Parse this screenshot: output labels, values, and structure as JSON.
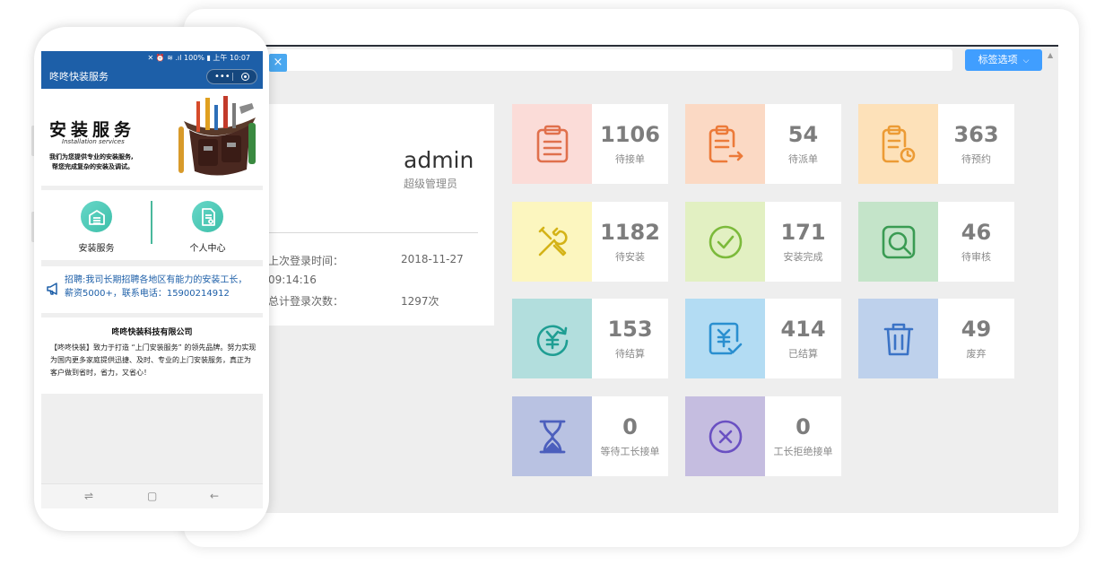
{
  "toolbar": {
    "close_glyph": "×",
    "options_label": "标签选项",
    "options_chevron": "⌵",
    "scroll_up": "▲"
  },
  "profile": {
    "name": "admin",
    "role": "超级管理员",
    "last_login_label": "上次登录时间：",
    "last_login_date": "2018-11-27",
    "last_login_time": "09:14:16",
    "login_count_label": "总计登录次数：",
    "login_count_value": "1297次"
  },
  "stats": [
    {
      "count": "1106",
      "label": "待接单",
      "icon": "clipboard-list-icon",
      "bg": "#fbdcd8",
      "color": "#e0704c"
    },
    {
      "count": "54",
      "label": "待派单",
      "icon": "clipboard-dispatch-icon",
      "bg": "#fbd9c4",
      "color": "#ec7a39"
    },
    {
      "count": "363",
      "label": "待预约",
      "icon": "clipboard-clock-icon",
      "bg": "#fde1b9",
      "color": "#ec9b35"
    },
    {
      "count": "1182",
      "label": "待安装",
      "icon": "tools-icon",
      "bg": "#fcf6bf",
      "color": "#d4b317"
    },
    {
      "count": "171",
      "label": "安装完成",
      "icon": "check-circle-icon",
      "bg": "#e2f0c2",
      "color": "#7cba3b"
    },
    {
      "count": "46",
      "label": "待审核",
      "icon": "search-check-icon",
      "bg": "#c4e4c9",
      "color": "#3a9b53"
    },
    {
      "count": "153",
      "label": "待结算",
      "icon": "yuan-refresh-icon",
      "bg": "#b2dedd",
      "color": "#1f9e93"
    },
    {
      "count": "414",
      "label": "已结算",
      "icon": "settled-check-icon",
      "bg": "#b3dcf3",
      "color": "#2a8fd0"
    },
    {
      "count": "49",
      "label": "废弃",
      "icon": "trash-icon",
      "bg": "#bed1ec",
      "color": "#3b73c6"
    },
    {
      "count": "0",
      "label": "等待工长接单",
      "icon": "hourglass-icon",
      "bg": "#b9c2e2",
      "color": "#4c5fbd"
    },
    {
      "count": "0",
      "label": "工长拒绝接单",
      "icon": "x-circle-icon",
      "bg": "#c5bde0",
      "color": "#6a50c2"
    }
  ],
  "phone": {
    "status_text": "✕ ⏰ ≋ .ıl 100% ▮ 上午 10:07",
    "app_title": "咚咚快装服务",
    "capsule_dots": "•••",
    "banner": {
      "title": "安装服务",
      "subtitle": "Installation services",
      "desc_line1": "我们为您提供专业的安装服务,",
      "desc_line2": "帮您完成复杂的安装及调试。"
    },
    "menu": [
      {
        "label": "安装服务",
        "icon": "garage-icon"
      },
      {
        "label": "个人中心",
        "icon": "profile-doc-icon"
      }
    ],
    "notice": "招聘:我司长期招聘各地区有能力的安装工长，薪资5000+，联系电话：15900214912",
    "company_name": "咚咚快装科技有限公司",
    "company_desc": "【咚咚快装】致力于打造 “上门安装服务” 的领先品牌。努力实现为国内更多家庭提供迅捷、及时、专业的上门安装服务，真正为客户做到省时，省力，又省心！",
    "nav": {
      "recent": "⇌",
      "home": "▢",
      "back": "←"
    }
  }
}
